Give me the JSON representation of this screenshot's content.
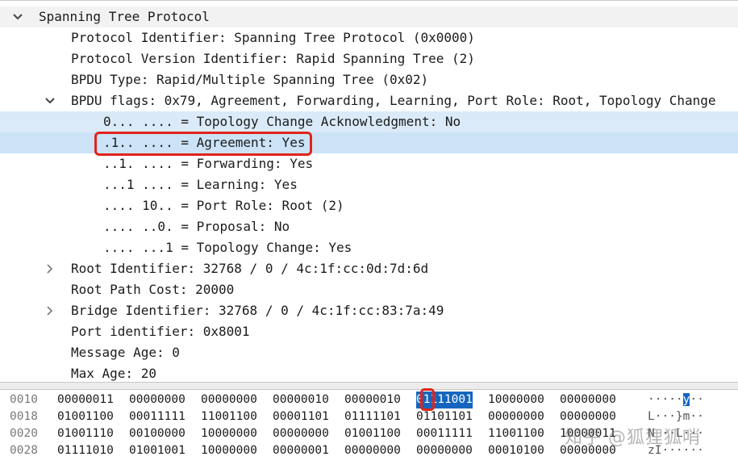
{
  "tree": {
    "rows": [
      {
        "text": "Spanning Tree Protocol",
        "chevron": "down"
      },
      {
        "text": "Protocol Identifier: Spanning Tree Protocol (0x0000)"
      },
      {
        "text": "Protocol Version Identifier: Rapid Spanning Tree (2)"
      },
      {
        "text": "BPDU Type: Rapid/Multiple Spanning Tree (0x02)"
      },
      {
        "text": "BPDU flags: 0x79, Agreement, Forwarding, Learning, Port Role: Root, Topology Change",
        "chevron": "down"
      },
      {
        "text": "0... .... = Topology Change Acknowledgment: No"
      },
      {
        "text": ".1.. .... = Agreement: Yes"
      },
      {
        "text": "..1. .... = Forwarding: Yes"
      },
      {
        "text": "...1 .... = Learning: Yes"
      },
      {
        "text": ".... 10.. = Port Role: Root (2)"
      },
      {
        "text": ".... ..0. = Proposal: No"
      },
      {
        "text": ".... ...1 = Topology Change: Yes"
      },
      {
        "text": "Root Identifier: 32768 / 0 / 4c:1f:cc:0d:7d:6d",
        "chevron": "right"
      },
      {
        "text": "Root Path Cost: 20000"
      },
      {
        "text": "Bridge Identifier: 32768 / 0 / 4c:1f:cc:83:7a:49",
        "chevron": "right"
      },
      {
        "text": "Port identifier: 0x8001"
      },
      {
        "text": "Message Age: 0"
      },
      {
        "text": "Max Age: 20"
      }
    ]
  },
  "hex": {
    "rows": [
      {
        "offset": "0010",
        "bytes": [
          "00000011",
          "00000000",
          "00000000",
          "00000010",
          "00000010",
          "01111001",
          "10000000",
          "00000000"
        ],
        "ascii_pre": "·····",
        "ascii_sel": "y",
        "ascii_post": "··"
      },
      {
        "offset": "0018",
        "bytes": [
          "01001100",
          "00011111",
          "11001100",
          "00001101",
          "01111101",
          "01101101",
          "00000000",
          "00000000"
        ],
        "ascii_pre": "L···}m··",
        "ascii_sel": "",
        "ascii_post": ""
      },
      {
        "offset": "0020",
        "bytes": [
          "01001110",
          "00100000",
          "10000000",
          "00000000",
          "01001100",
          "00011111",
          "11001100",
          "10000011"
        ],
        "ascii_pre": "N ··L···",
        "ascii_sel": "",
        "ascii_post": ""
      },
      {
        "offset": "0028",
        "bytes": [
          "01111010",
          "01001001",
          "10000000",
          "00000001",
          "00000000",
          "00000000",
          "00010100",
          "00000000"
        ],
        "ascii_pre": "zI······",
        "ascii_sel": "",
        "ascii_post": ""
      }
    ]
  },
  "watermark": "知乎 @狐狸狐哨"
}
